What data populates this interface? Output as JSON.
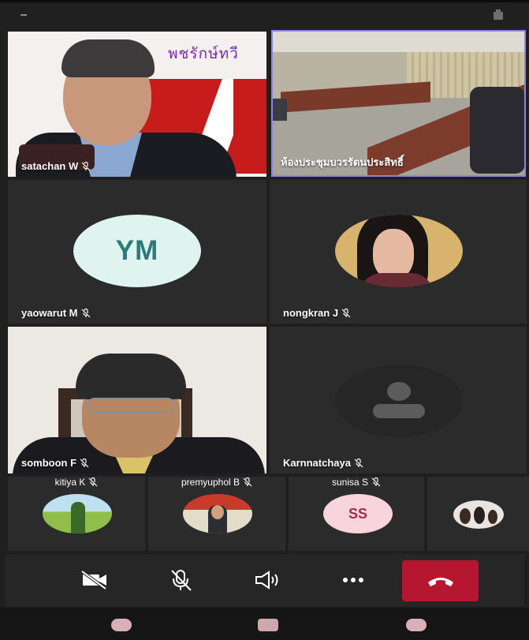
{
  "participants": {
    "satachan": "satachan W",
    "room": "ห้องประชุมบวรรัตนประสิทธิ์",
    "yaowarut": "yaowarut M",
    "yaowarut_initials": "YM",
    "nongkran": "nongkran J",
    "somboon": "somboon F",
    "karnnatchaya": "Karnnatchaya",
    "kitiya": "kitiya K",
    "premyuphol": "premyuphol B",
    "sunisa": "sunisa S",
    "sunisa_initials": "SS"
  },
  "background_text": "พชรักษ์ทวี",
  "colors": {
    "end_call": "#b4172f",
    "active_speaker_border": "#8a86d8",
    "ym_avatar_bg": "#dff3ef",
    "ym_avatar_text": "#2b7b7a",
    "ss_avatar_bg": "#f8d4dc",
    "ss_avatar_text": "#a62a4a"
  },
  "icons": {
    "controls": [
      "video-off-icon",
      "mic-off-icon",
      "speaker-icon",
      "more-icon",
      "end-call-icon"
    ],
    "tile_badge": "mic-off-icon"
  }
}
